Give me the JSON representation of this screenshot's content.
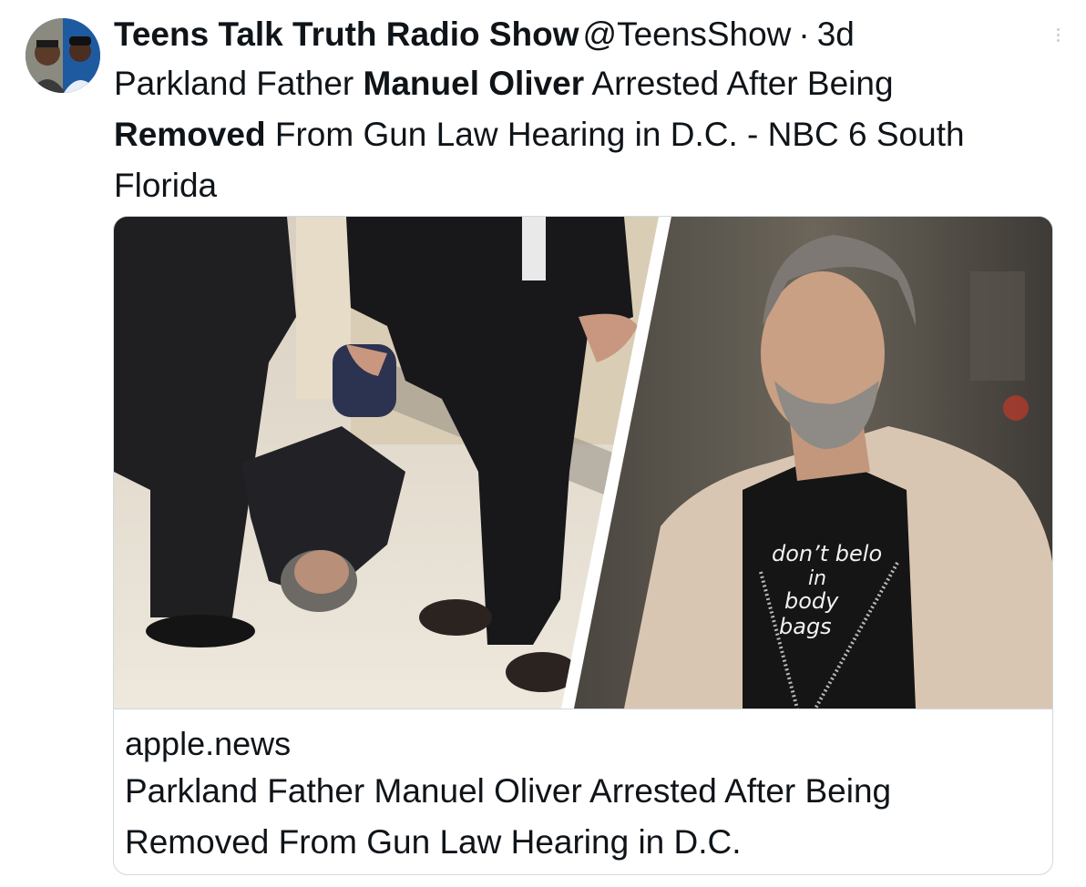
{
  "tweet": {
    "display_name": "Teens Talk Truth Radio Show",
    "handle": "@TeensShow",
    "separator": "·",
    "time": "3d",
    "text_parts": {
      "p1": "Parkland Father ",
      "p2_bold": "Manuel Oliver",
      "p3": " Arrested After Being ",
      "p4_bold": "Removed",
      "p5": " From Gun Law Hearing in D.C. - NBC 6 South Florida"
    },
    "more_icon": "more-vertical-icon"
  },
  "card": {
    "domain": "apple.news",
    "title": "Parkland Father Manuel Oliver Arrested After Being Removed From Gun Law Hearing in D.C.",
    "shirt_text": {
      "l1": "don’t belo",
      "l2": "in",
      "l3": "body",
      "l4": "bags"
    }
  },
  "colors": {
    "text": "#0f1419",
    "border": "#cfd9de",
    "more_dots": "#c4cfd6"
  }
}
